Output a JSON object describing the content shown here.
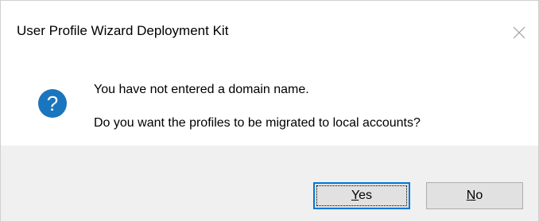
{
  "dialog": {
    "title": "User Profile Wizard Deployment Kit",
    "close_symbol": "×",
    "icon": "question-icon",
    "message_line1": "You have not entered a domain name.",
    "message_line2": "Do you want the profiles to be migrated to local accounts?",
    "buttons": {
      "yes": {
        "mnemonic": "Y",
        "rest": "es"
      },
      "no": {
        "mnemonic": "N",
        "rest": "o"
      }
    }
  },
  "colors": {
    "footer_bg": "#f0f0f0",
    "button_bg": "#e1e1e1",
    "accent": "#0078d7",
    "icon_fill": "#1a75bf"
  }
}
